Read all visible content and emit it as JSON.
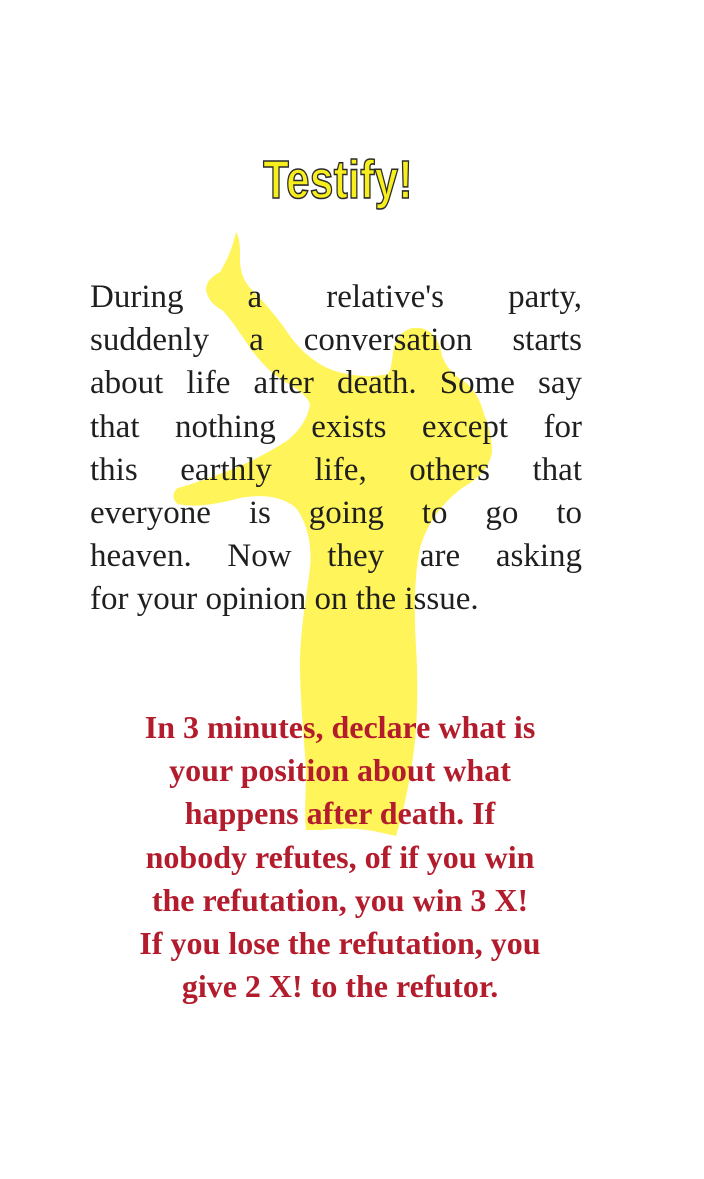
{
  "card": {
    "title": "Testify!",
    "scenario_lines": [
      "During a relative's party,",
      "suddenly a conversation starts",
      "about life after death.  Some say",
      "that nothing exists except for",
      "this earthly life, others that",
      "everyone is going to go to",
      "heaven.  Now they are asking",
      "for your opinion on the issue."
    ],
    "instruction_lines": [
      "In 3 minutes, declare what is",
      "your position about what",
      "happens after death.  If",
      "nobody refutes, of if you win",
      "the refutation, you win 3 X!",
      "If you lose the refutation, you",
      "give 2 X! to the refutor."
    ]
  },
  "colors": {
    "title_fill": "#f7ee1e",
    "title_outline": "#2b2b2b",
    "silhouette": "#fff45a",
    "body_text": "#1f1f1f",
    "instruction_text": "#b31c2c"
  },
  "icons": {
    "background_figure": "raised-hand-person-silhouette"
  }
}
